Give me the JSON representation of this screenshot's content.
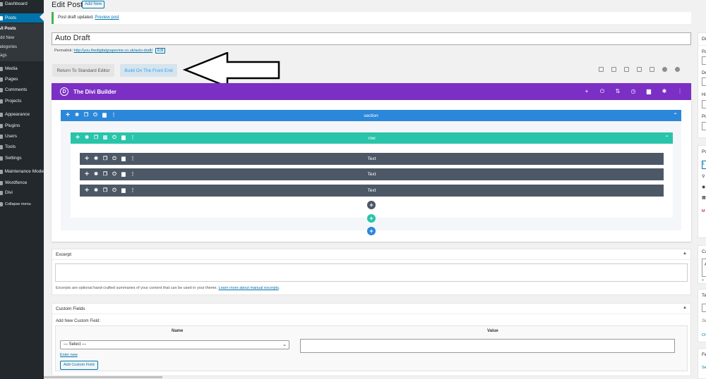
{
  "sidebar": {
    "items": [
      {
        "label": "Dashboard",
        "icon": "dashboard-icon"
      },
      {
        "label": "Posts",
        "icon": "pin-icon",
        "active": true
      },
      {
        "label": "Media",
        "icon": "media-icon"
      },
      {
        "label": "Pages",
        "icon": "page-icon"
      },
      {
        "label": "Comments",
        "icon": "comment-icon"
      },
      {
        "label": "Projects",
        "icon": "portfolio-icon"
      },
      {
        "label": "Appearance",
        "icon": "brush-icon"
      },
      {
        "label": "Plugins",
        "icon": "plug-icon"
      },
      {
        "label": "Users",
        "icon": "user-icon"
      },
      {
        "label": "Tools",
        "icon": "wrench-icon"
      },
      {
        "label": "Settings",
        "icon": "settings-icon"
      },
      {
        "label": "Maintenance Mode",
        "icon": "maintenance-icon"
      },
      {
        "label": "Wordfence",
        "icon": "shield-icon"
      },
      {
        "label": "Divi",
        "icon": "divi-icon"
      },
      {
        "label": "Collapse menu",
        "icon": "collapse-icon"
      }
    ],
    "submenu": [
      "All Posts",
      "Add New",
      "Categories",
      "Tags"
    ]
  },
  "header": {
    "title": "Edit Post",
    "add_new": "Add New"
  },
  "notice": {
    "text": "Post draft updated.",
    "link": "Preview post"
  },
  "post": {
    "title": "Auto Draft",
    "permalink_label": "Permalink:",
    "permalink_url": "http://you.thedigitalgrapevine.co.uk/auto-draft/",
    "permalink_edit": "Edit"
  },
  "editor_buttons": {
    "standard": "Return To Standard Editor",
    "front_end": "Build On The Front End"
  },
  "toolbar_icons": [
    "layout-icon",
    "search-icon",
    "desktop-icon",
    "tablet-icon",
    "phone-icon",
    "portability-icon",
    "help-icon"
  ],
  "divi": {
    "title": "The Divi Builder",
    "logo_letter": "D",
    "header_actions": [
      "add-icon",
      "power-icon",
      "sort-icon",
      "history-icon",
      "trash-icon",
      "gear-icon",
      "more-icon"
    ],
    "section_label": "section",
    "row_label": "row",
    "modules": [
      "Text",
      "Text",
      "Text"
    ],
    "colors": {
      "header": "#7b2fc4",
      "section": "#2b87da",
      "row": "#29c4a9",
      "module": "#4c5866"
    }
  },
  "excerpt": {
    "title": "Excerpt",
    "note": "Excerpts are optional hand-crafted summaries of your content that can be used in your theme.",
    "note_link": "Learn more about manual excerpts"
  },
  "custom_fields": {
    "title": "Custom Fields",
    "subtitle": "Add New Custom Field:",
    "col_name": "Name",
    "col_value": "Value",
    "select_placeholder": "— Select —",
    "enter_new": "Enter new",
    "add_button": "Add Custom Field"
  },
  "right_sidebar": {
    "box1_title": "Di",
    "box1_labels": [
      "Pa",
      "De",
      "Hi",
      "Po"
    ],
    "box2_title": "Pu",
    "box2_links": [
      "S",
      "M"
    ],
    "box3_title": "Ca",
    "box3_items": [
      "A"
    ],
    "box3_link": "+",
    "box4_title": "Ta",
    "box4_links": [
      "Se",
      "Ch"
    ],
    "box5_title": "Fe",
    "box5_link": "Se"
  }
}
